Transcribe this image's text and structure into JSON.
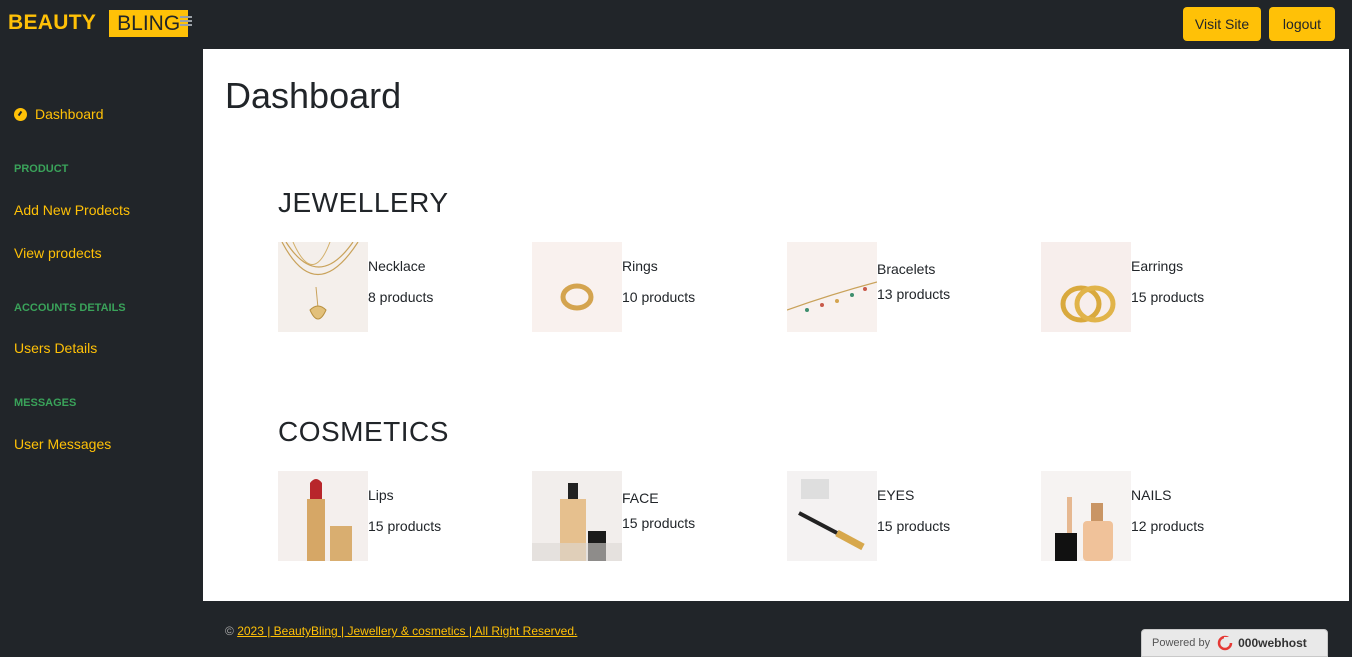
{
  "brand": {
    "part1": "BEAUTY",
    "part2": "BLING"
  },
  "header": {
    "visit_label": "Visit Site",
    "logout_label": "logout"
  },
  "sidebar": {
    "dashboard": "Dashboard",
    "sections": [
      {
        "heading": "PRODUCT",
        "links": [
          "Add New Prodects",
          "View prodects"
        ]
      },
      {
        "heading": "ACCOUNTS DETAILS",
        "links": [
          "Users Details"
        ]
      },
      {
        "heading": "MESSAGES",
        "links": [
          "User Messages"
        ]
      }
    ]
  },
  "main": {
    "title": "Dashboard",
    "jewellery": {
      "heading": "JEWELLERY",
      "items": [
        {
          "name": "Necklace",
          "count": "8 products"
        },
        {
          "name": "Rings",
          "count": "10 products"
        },
        {
          "name": "Bracelets",
          "count": "13 products"
        },
        {
          "name": "Earrings",
          "count": "15 products"
        }
      ]
    },
    "cosmetics": {
      "heading": "COSMETICS",
      "items": [
        {
          "name": "Lips",
          "count": "15 products"
        },
        {
          "name": "FACE",
          "count": "15 products"
        },
        {
          "name": "EYES",
          "count": "15 products"
        },
        {
          "name": "NAILS",
          "count": "12 products"
        }
      ]
    }
  },
  "footer": {
    "copy_symbol": "©",
    "link_text": "2023 | BeautyBling | Jewellery & cosmetics | All Right Reserved.",
    "powered_by": "Powered by",
    "host": "000webhost"
  },
  "colors": {
    "accent": "#ffc107",
    "dark": "#212529",
    "section_heading": "#3aa35a"
  }
}
